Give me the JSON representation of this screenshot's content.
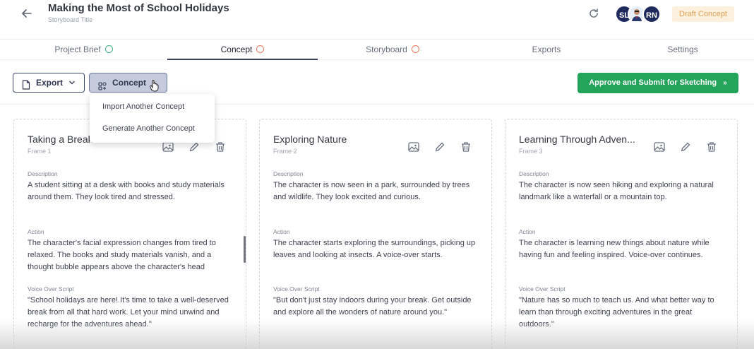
{
  "header": {
    "title": "Making the Most of School Holidays",
    "subtitle": "Storyboard Title",
    "avatars": [
      "SL",
      "",
      "RN"
    ],
    "status_badge": "Draft Concept"
  },
  "tabs": [
    {
      "label": "Project Brief",
      "status": "done"
    },
    {
      "label": "Concept",
      "status": "in-progress",
      "active": true
    },
    {
      "label": "Storyboard",
      "status": "in-progress"
    },
    {
      "label": "Exports"
    },
    {
      "label": "Settings"
    }
  ],
  "toolbar": {
    "export_label": "Export",
    "concept_label": "Concept",
    "approve_label": "Approve and Submit for Sketching"
  },
  "dropdown": {
    "items": [
      "Import Another Concept",
      "Generate Another Concept"
    ]
  },
  "section_labels": {
    "description": "Description",
    "action": "Action",
    "voice_over": "Voice Over Script"
  },
  "frames": [
    {
      "title": "Taking a Break",
      "frame": "Frame 1",
      "description": "A student sitting at a desk with books and study materials around them. They look tired and stressed.",
      "action": "The character's facial expression changes from tired to relaxed. The books and study materials vanish, and a thought bubble appears above the character's head",
      "voice_over": "\"School holidays are here! It's time to take a well-deserved break from all that hard work. Let your mind unwind and recharge for the adventures ahead.\""
    },
    {
      "title": "Exploring Nature",
      "frame": "Frame 2",
      "description": "The character is now seen in a park, surrounded by trees and wildlife. They look excited and curious.",
      "action": "The character starts exploring the surroundings, picking up leaves and looking at insects. A voice-over starts.",
      "voice_over": "\"But don't just stay indoors during your break. Get outside and explore all the wonders of nature around you.\""
    },
    {
      "title": "Learning Through Adven...",
      "frame": "Frame 3",
      "description": "The character is now seen hiking and exploring a natural landmark like a waterfall or a mountain top.",
      "action": "The character is learning new things about nature while having fun and feeling inspired. Voice-over continues.",
      "voice_over": "\"Nature has so much to teach us. And what better way to learn than through exciting adventures in the great outdoors.\""
    }
  ],
  "colors": {
    "accent_green": "#23a45b",
    "navy": "#1e2a5e",
    "draft_badge_bg": "#fdf0dc",
    "draft_badge_text": "#e0a055"
  }
}
